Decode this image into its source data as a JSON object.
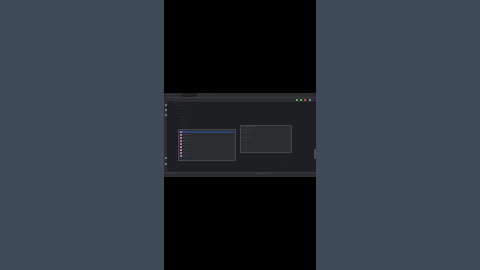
{
  "colors": {
    "page_background": "#3e4a57",
    "video_letterbox": "#000000",
    "ide_background": "#1e1f22",
    "ide_chrome": "#2b2d30",
    "selection": "#2e436e",
    "accent": "#3592c4"
  },
  "ide": {
    "tabs": [
      {
        "label": "·····",
        "active": false
      },
      {
        "label": "·······",
        "active": true
      },
      {
        "label": "····",
        "active": false
      },
      {
        "label": "·····",
        "active": false
      }
    ],
    "toolbar_icons": [
      "run-icon",
      "debug-icon",
      "stop-icon",
      "settings-icon"
    ],
    "left_tool_icons": [
      "project-icon",
      "structure-icon",
      "bookmarks-icon",
      "git-icon",
      "terminal-icon"
    ],
    "status": {
      "left": "···· ···",
      "right": "···· ··· ···· ····"
    }
  }
}
